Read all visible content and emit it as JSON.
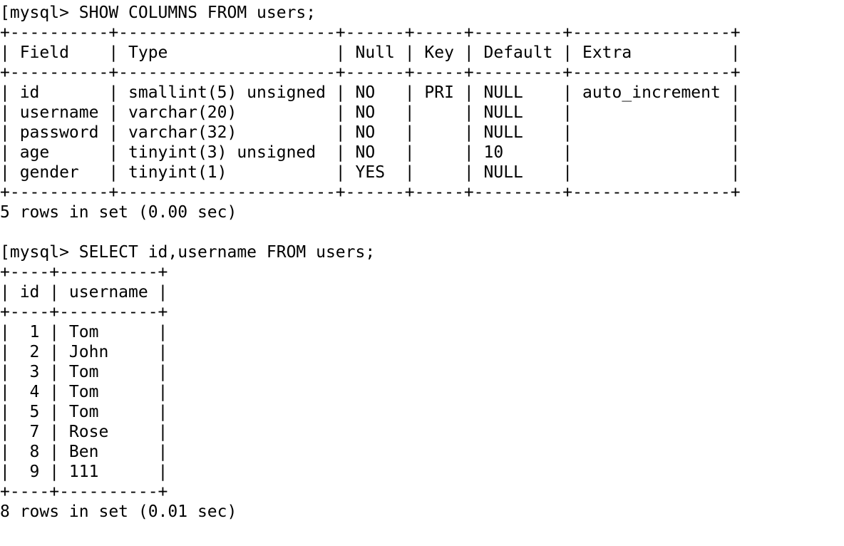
{
  "terminal": {
    "background_color": "#ffffff",
    "text_color": "#000000",
    "prompt": "mysql>",
    "leading_artifact": "[",
    "blocks": [
      {
        "name": "show-columns-block",
        "command": "SHOW COLUMNS FROM users;",
        "prompt_line": "[mysql> SHOW COLUMNS FROM users;",
        "table": {
          "columns": [
            {
              "header": "Field",
              "width": 10,
              "align": "left"
            },
            {
              "header": "Type",
              "width": 22,
              "align": "left"
            },
            {
              "header": "Null",
              "width": 6,
              "align": "left"
            },
            {
              "header": "Key",
              "width": 5,
              "align": "left"
            },
            {
              "header": "Default",
              "width": 9,
              "align": "left"
            },
            {
              "header": "Extra",
              "width": 16,
              "align": "left"
            }
          ],
          "rows": [
            {
              "Field": "id",
              "Type": "smallint(5) unsigned",
              "Null": "NO",
              "Key": "PRI",
              "Default": "NULL",
              "Extra": "auto_increment"
            },
            {
              "Field": "username",
              "Type": "varchar(20)",
              "Null": "NO",
              "Key": "",
              "Default": "NULL",
              "Extra": ""
            },
            {
              "Field": "password",
              "Type": "varchar(32)",
              "Null": "NO",
              "Key": "",
              "Default": "NULL",
              "Extra": ""
            },
            {
              "Field": "age",
              "Type": "tinyint(3) unsigned",
              "Null": "NO",
              "Key": "",
              "Default": "10",
              "Extra": ""
            },
            {
              "Field": "gender",
              "Type": "tinyint(1)",
              "Null": "YES",
              "Key": "",
              "Default": "NULL",
              "Extra": ""
            }
          ]
        },
        "status": "5 rows in set (0.00 sec)",
        "row_count": 5,
        "elapsed": "0.00 sec"
      },
      {
        "name": "select-users-block",
        "command": "SELECT id,username FROM users;",
        "prompt_line": "[mysql> SELECT id,username FROM users;",
        "table": {
          "columns": [
            {
              "header": "id",
              "width": 4,
              "align": "right"
            },
            {
              "header": "username",
              "width": 10,
              "align": "left"
            }
          ],
          "rows": [
            {
              "id": "1",
              "username": "Tom"
            },
            {
              "id": "2",
              "username": "John"
            },
            {
              "id": "3",
              "username": "Tom"
            },
            {
              "id": "4",
              "username": "Tom"
            },
            {
              "id": "5",
              "username": "Tom"
            },
            {
              "id": "7",
              "username": "Rose"
            },
            {
              "id": "8",
              "username": "Ben"
            },
            {
              "id": "9",
              "username": "111"
            }
          ]
        },
        "status": "8 rows in set (0.01 sec)",
        "row_count": 8,
        "elapsed": "0.01 sec"
      }
    ]
  }
}
